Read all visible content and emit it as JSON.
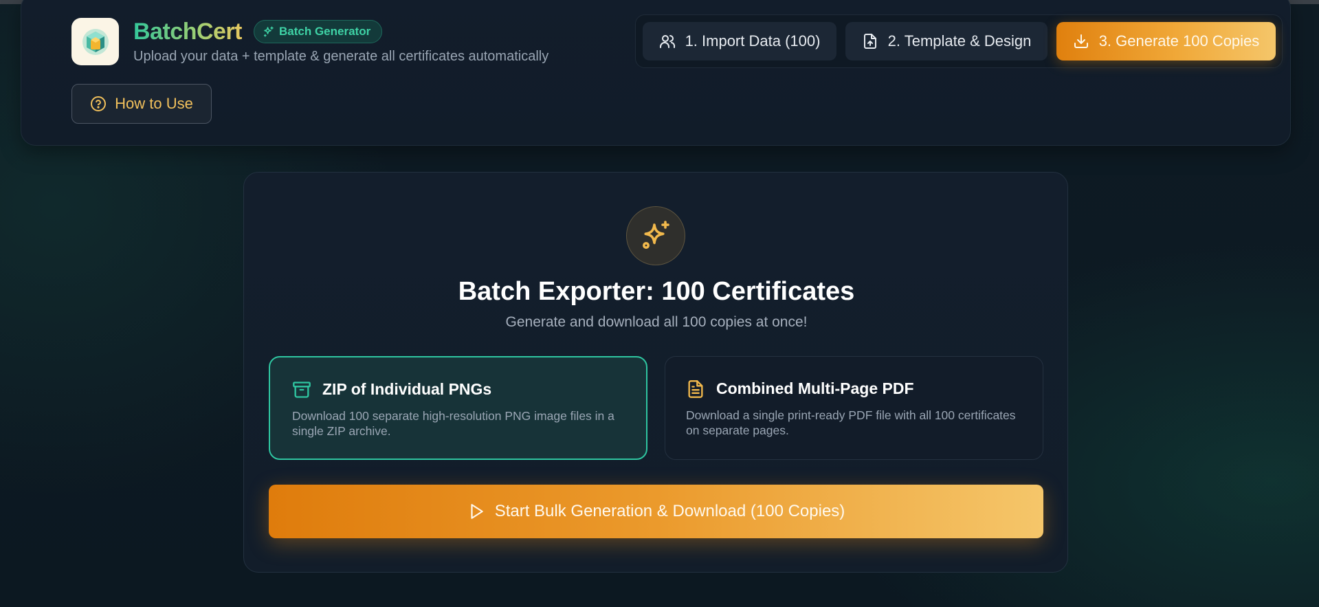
{
  "header": {
    "brand": "BatchCert",
    "badge": "Batch Generator",
    "subtitle": "Upload your data + template & generate all certificates automatically",
    "how_to_use": "How to Use",
    "steps": [
      {
        "label": "1. Import Data (100)",
        "icon": "users-icon",
        "active": false
      },
      {
        "label": "2. Template & Design",
        "icon": "file-upload-icon",
        "active": false
      },
      {
        "label": "3. Generate 100 Copies",
        "icon": "download-icon",
        "active": true
      }
    ]
  },
  "main": {
    "icon": "sparkles-icon",
    "title": "Batch Exporter: 100 Certificates",
    "subtitle": "Generate and download all 100 copies at once!",
    "options": [
      {
        "title": "ZIP of Individual PNGs",
        "desc": "Download 100 separate high-resolution PNG image files in a single ZIP archive.",
        "icon": "archive-icon",
        "selected": true
      },
      {
        "title": "Combined Multi-Page PDF",
        "desc": "Download a single print-ready PDF file with all 100 certificates on separate pages.",
        "icon": "file-text-icon",
        "selected": false
      }
    ],
    "start_button": "Start Bulk Generation & Download (100 Copies)"
  },
  "colors": {
    "accent_orange": "#e0800e",
    "accent_gold": "#f5c66a",
    "accent_teal": "#2fc6a1",
    "background": "#0e1b24"
  }
}
